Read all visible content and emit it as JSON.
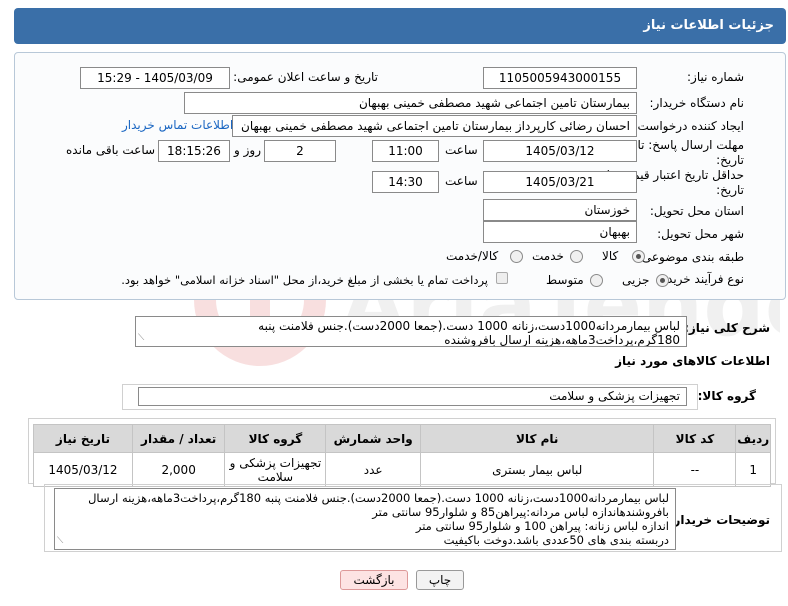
{
  "header": {
    "title": "جزئیات اطلاعات نیاز"
  },
  "form": {
    "need_number": {
      "label": "شماره نیاز:",
      "value": "1105005943000155"
    },
    "announce_datetime": {
      "label": "تاریخ و ساعت اعلان عمومی:",
      "value": "1405/03/09 - 15:29"
    },
    "buyer_org": {
      "label": "نام دستگاه خریدار:",
      "value": "بیمارستان تامین اجتماعی شهید مصطفی خمینی بهبهان"
    },
    "requester": {
      "label": "ایجاد کننده درخواست:",
      "value": "احسان رضائی کارپرداز بیمارستان تامین اجتماعی شهید مصطفی خمینی بهبهان",
      "contact_link": "اطلاعات تماس خریدار"
    },
    "reply_deadline": {
      "label": "مهلت ارسال پاسخ: تا تاریخ:",
      "date": "1405/03/12",
      "time_label": "ساعت",
      "time": "11:00",
      "days": "2",
      "days_label": "روز و",
      "remaining": "18:15:26",
      "remaining_label": "ساعت باقی مانده"
    },
    "price_validity": {
      "label": "حداقل تاریخ اعتبار قیمت: تا تاریخ:",
      "date": "1405/03/21",
      "time_label": "ساعت",
      "time": "14:30"
    },
    "province": {
      "label": "استان محل تحویل:",
      "value": "خوزستان"
    },
    "city": {
      "label": "شهر محل تحویل:",
      "value": "بهبهان"
    },
    "category": {
      "label": "طبقه بندی موضوعی:",
      "options": [
        "کالا",
        "خدمت",
        "کالا/خدمت"
      ],
      "selected": "کالا"
    },
    "purchase_type": {
      "label": "نوع فرآیند خرید :",
      "options": [
        "جزیی",
        "متوسط"
      ],
      "selected": "جزیی",
      "treasury_note": "پرداخت تمام یا بخشی از مبلغ خرید،از محل \"اسناد خزانه اسلامی\" خواهد بود."
    }
  },
  "general_description": {
    "label": "شرح کلی نیاز:",
    "text": "لباس بیمارمردانه1000دست،زنانه 1000 دست.(جمعا 2000دست).جنس فلامنت پنبه 180گرم،پرداخت3ماهه،هزینه ارسال بافروشنده"
  },
  "goods_info": {
    "title": "اطلاعات کالاهای مورد نیاز",
    "group_label": "گروه کالا:",
    "group_value": "تجهیزات پزشکی و سلامت"
  },
  "items_table": {
    "headers": [
      "ردیف",
      "کد کالا",
      "نام کالا",
      "واحد شمارش",
      "گروه کالا",
      "تعداد / مقدار",
      "تاریخ نیاز"
    ],
    "rows": [
      [
        "1",
        "--",
        "لباس بیمار بستری",
        "عدد",
        "تجهیزات پزشکی و سلامت",
        "2,000",
        "1405/03/12"
      ]
    ]
  },
  "buyer_notes": {
    "label": "توضیحات خریدار:",
    "lines": [
      "لباس بیمارمردانه1000دست،زنانه 1000 دست.(جمعا 2000دست).جنس فلامنت پنبه 180گرم،پرداخت3ماهه،هزینه ارسال",
      "بافروشندهاندازه لباس مردانه:پیراهن85 و شلوار95 سانتی متر",
      "اندازه لباس زنانه: پیراهن 100 و شلوار95 سانتی متر",
      "دربسته بندی های 50عددی باشد.دوخت باکیفیت"
    ]
  },
  "buttons": {
    "print": "چاپ",
    "back": "بازگشت"
  },
  "colors": {
    "header": "#3a6fa8",
    "link": "#1a66c2",
    "back_button": "#fde3e3"
  }
}
